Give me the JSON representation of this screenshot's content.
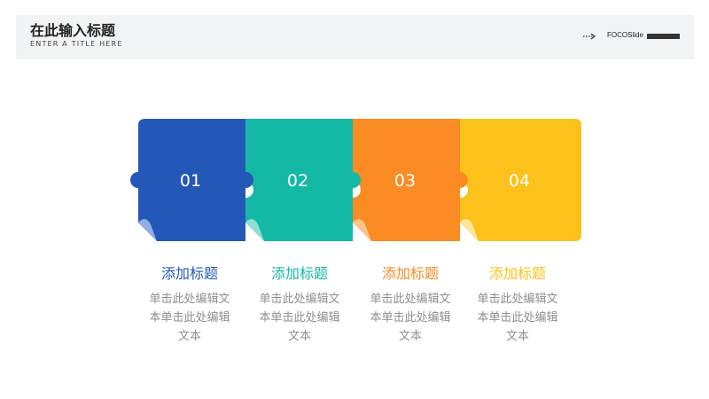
{
  "header": {
    "title": "在此输入标题",
    "subtitle": "ENTER A TITLE HERE",
    "brand": "FOCOSlide",
    "icon": "dotted-arrow-icon"
  },
  "colors": {
    "blue": "#2458b8",
    "teal": "#14b9a6",
    "orange": "#fb8b23",
    "yellow": "#fcc11a"
  },
  "steps": [
    {
      "number": "01",
      "title": "添加标题",
      "desc_line1": "单击此处编辑文",
      "desc_line2": "本单击此处编辑",
      "desc_line3": "文本"
    },
    {
      "number": "02",
      "title": "添加标题",
      "desc_line1": "单击此处编辑文",
      "desc_line2": "本单击此处编辑",
      "desc_line3": "文本"
    },
    {
      "number": "03",
      "title": "添加标题",
      "desc_line1": "单击此处编辑文",
      "desc_line2": "本单击此处编辑",
      "desc_line3": "文本"
    },
    {
      "number": "04",
      "title": "添加标题",
      "desc_line1": "单击此处编辑文",
      "desc_line2": "本单击此处编辑",
      "desc_line3": "文本"
    }
  ]
}
